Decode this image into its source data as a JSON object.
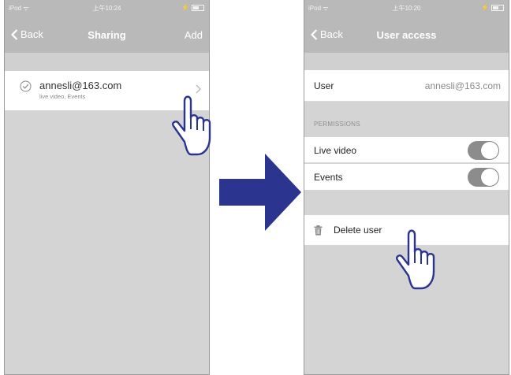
{
  "left_screen": {
    "status": {
      "carrier": "iPod ᯤ",
      "time": "上午10:24"
    },
    "nav": {
      "back_label": "Back",
      "title": "Sharing",
      "add_label": "Add"
    },
    "account": {
      "email": "annesli@163.com",
      "permissions_summary": "live video, Events"
    }
  },
  "right_screen": {
    "status": {
      "carrier": "iPod ᯤ",
      "time": "上午10:20"
    },
    "nav": {
      "back_label": "Back",
      "title": "User access"
    },
    "user_row": {
      "label": "User",
      "value": "annesli@163.com"
    },
    "permissions": {
      "header": "PERMISSIONS",
      "items": [
        {
          "label": "Live video",
          "enabled": true
        },
        {
          "label": "Events",
          "enabled": true
        }
      ]
    },
    "delete_label": "Delete user"
  },
  "colors": {
    "nav_bar": "#b9b9b9",
    "background": "#d4d4d4",
    "toggle_track": "#8c8c8c",
    "arrow": "#2b3590"
  },
  "icons": [
    "check-circle-icon",
    "chevron-right-icon",
    "back-chevron-icon",
    "trash-icon",
    "pointing-hand-icon",
    "arrow-right-icon"
  ]
}
